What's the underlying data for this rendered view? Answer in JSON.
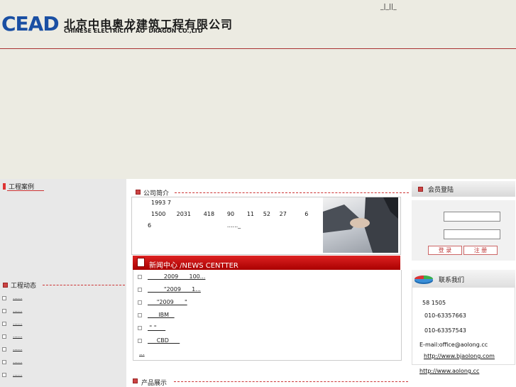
{
  "header": {
    "logo_mark": "CEAD",
    "company_name_cn": "北京中电奥龙建筑工程有限公司",
    "company_name_en": "CHINESE ELECTRICITY AO' DRAGON CO.,LTD",
    "top_nav": "_|_||_"
  },
  "left": {
    "cases_title": "工程案例",
    "news_title": "工程动态",
    "news_items": [
      "......",
      "......",
      "......",
      "......",
      "......",
      "......",
      "......"
    ]
  },
  "intro": {
    "title": "公司简介",
    "lines": [
      "1993 7",
      "1500      2031       418       90       11     52     27          6",
      "6                                          ......_"
    ]
  },
  "news_center": {
    "title": "新闻中心 /NEWS CENTTER",
    "items": [
      "         2009      100...",
      "         \"2009      1...",
      "     \"2009      \"",
      "      IBM   ",
      " \" \"     ",
      "     CBD      "
    ],
    "more": "..."
  },
  "login": {
    "title": "会员登陆",
    "login_button": "登 录",
    "register_button": "注 册"
  },
  "contact": {
    "title": "联系我们",
    "lines": [
      "58 1505",
      "010-63357663",
      "010-63357543",
      "E-mail:office@aolong.cc",
      "http://www.bjaolong.com",
      "http://www.aolong.cc"
    ]
  },
  "products": {
    "title": "产品展示"
  },
  "colors": {
    "accent_red": "#cc2222",
    "logo_blue": "#1a4fa3",
    "background": "#ecebe2"
  }
}
